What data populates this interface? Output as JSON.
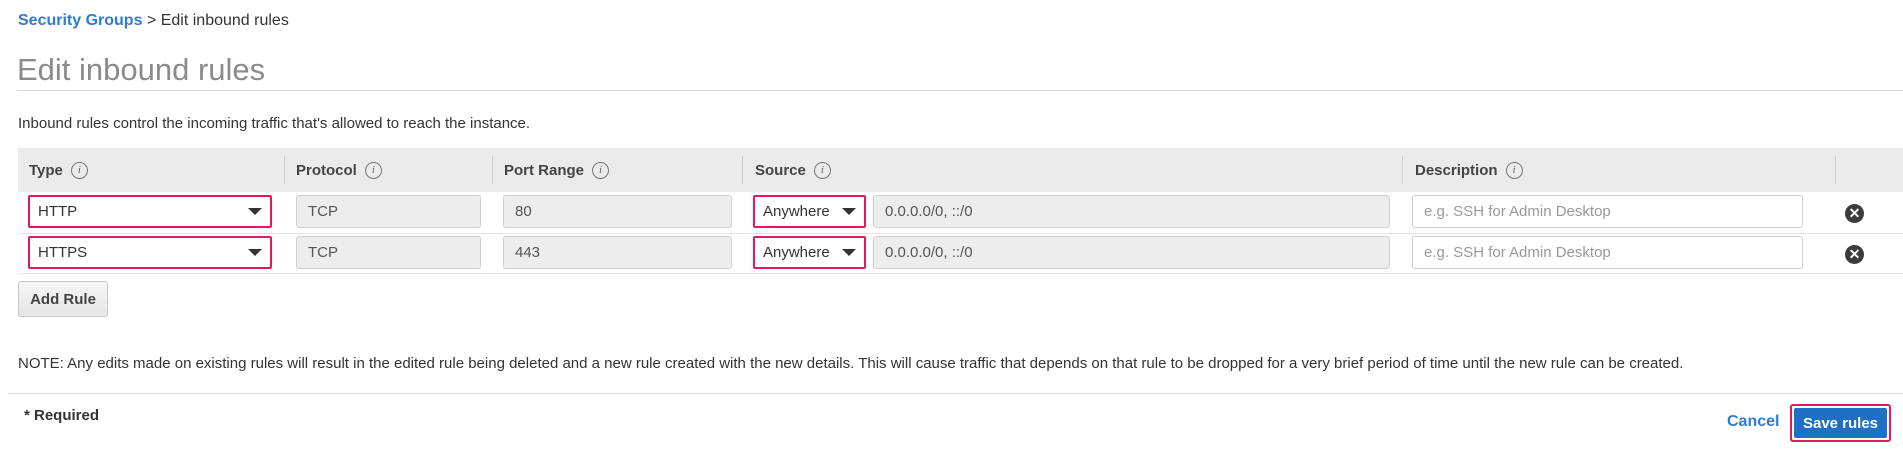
{
  "breadcrumb": {
    "parent": "Security Groups",
    "separator": ">",
    "current": "Edit inbound rules"
  },
  "page_title": "Edit inbound rules",
  "intro": "Inbound rules control the incoming traffic that's allowed to reach the instance.",
  "columns": {
    "type": "Type",
    "protocol": "Protocol",
    "port_range": "Port Range",
    "source": "Source",
    "description": "Description",
    "info_glyph": "i"
  },
  "rules": [
    {
      "type": "HTTP",
      "protocol": "TCP",
      "port_range": "80",
      "source": "Anywhere",
      "cidr": "0.0.0.0/0, ::/0",
      "description_placeholder": "e.g. SSH for Admin Desktop"
    },
    {
      "type": "HTTPS",
      "protocol": "TCP",
      "port_range": "443",
      "source": "Anywhere",
      "cidr": "0.0.0.0/0, ::/0",
      "description_placeholder": "e.g. SSH for Admin Desktop"
    }
  ],
  "remove_glyph": "✕",
  "add_rule_label": "Add Rule",
  "note": "NOTE: Any edits made on existing rules will result in the edited rule being deleted and a new rule created with the new details. This will cause traffic that depends on that rule to be dropped for a very brief period of time until the new rule can be created.",
  "required_label": "* Required",
  "cancel_label": "Cancel",
  "save_label": "Save rules",
  "colors": {
    "link": "#2e7bd6",
    "highlight": "#e6195f",
    "primary": "#1f6fc5"
  },
  "icons": {
    "info": "info-icon",
    "remove": "remove-circle-icon",
    "dropdown": "chevron-down-icon"
  }
}
